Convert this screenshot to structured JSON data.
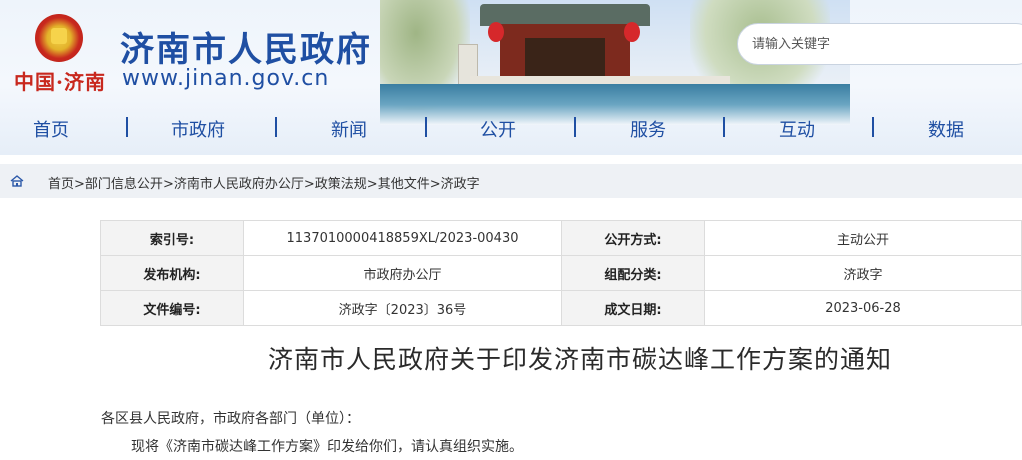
{
  "header": {
    "logo_text": "中国·济南",
    "site_title": "济南市人民政府",
    "site_url": "www.jinan.gov.cn",
    "search_placeholder": "请输入关键字"
  },
  "nav": {
    "items": [
      {
        "label": "首页"
      },
      {
        "label": "市政府"
      },
      {
        "label": "新闻"
      },
      {
        "label": "公开"
      },
      {
        "label": "服务"
      },
      {
        "label": "互动"
      },
      {
        "label": "数据"
      }
    ]
  },
  "breadcrumb": {
    "items": [
      "首页",
      "部门信息公开",
      "济南市人民政府办公厅",
      "政策法规",
      "其他文件",
      "济政字"
    ],
    "separator": ">"
  },
  "meta": {
    "index_label": "索引号:",
    "index_value": "1137010000418859XL/2023-00430",
    "open_mode_label": "公开方式:",
    "open_mode_value": "主动公开",
    "issuer_label": "发布机构:",
    "issuer_value": "市政府办公厅",
    "category_label": "组配分类:",
    "category_value": "济政字",
    "doc_no_label": "文件编号:",
    "doc_no_value": "济政字〔2023〕36号",
    "date_label": "成文日期:",
    "date_value": "2023-06-28"
  },
  "article": {
    "title": "济南市人民政府关于印发济南市碳达峰工作方案的通知",
    "salutation": "各区县人民政府，市政府各部门（单位）：",
    "body": "现将《济南市碳达峰工作方案》印发给你们，请认真组织实施。"
  },
  "colors": {
    "brand_blue": "#1f4fa3",
    "emblem_red": "#c8281e"
  }
}
